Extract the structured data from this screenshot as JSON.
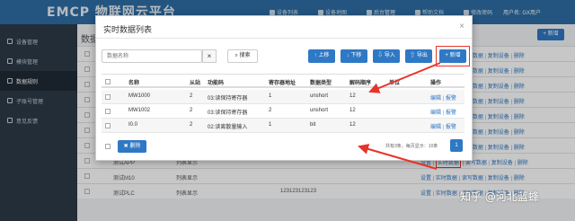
{
  "app": {
    "logo": "EMCP 物联网云平台"
  },
  "topnav": [
    "设备列表",
    "设备地图",
    "后台管理",
    "帮助文档",
    "修改密码"
  ],
  "user": {
    "label": "用户名: GX用户"
  },
  "sidebar": {
    "items": [
      {
        "label": "设备管理",
        "active": false
      },
      {
        "label": "模块管理",
        "active": false
      },
      {
        "label": "数据规则",
        "active": true
      },
      {
        "label": "子账号管理",
        "active": false
      },
      {
        "label": "意见反馈",
        "active": false
      }
    ]
  },
  "background": {
    "title": "数据",
    "add_label": "+ 新增",
    "rows": [
      {
        "name": "",
        "desc": "",
        "actions": [
          "设置",
          "实时数据",
          "读写数据",
          "复制设备",
          "删除"
        ]
      },
      {
        "name": "",
        "desc": "",
        "actions": [
          "设置",
          "实时数据",
          "读写数据",
          "复制设备",
          "删除"
        ]
      },
      {
        "name": "",
        "desc": "",
        "actions": [
          "设置",
          "实时数据",
          "读写数据",
          "复制设备",
          "删除"
        ]
      },
      {
        "name": "",
        "desc": "",
        "actions": [
          "设置",
          "实时数据",
          "读写数据",
          "复制设备",
          "删除"
        ]
      },
      {
        "name": "",
        "desc": "",
        "actions": [
          "设置",
          "实时数据",
          "读写数据",
          "复制设备",
          "删除"
        ]
      },
      {
        "name": "",
        "desc": "",
        "actions": [
          "设置",
          "实时数据",
          "读写数据",
          "复制设备",
          "删除"
        ]
      },
      {
        "name": "",
        "desc": "",
        "actions": [
          "设置",
          "实时数据",
          "读写数据",
          "复制设备",
          "删除"
        ]
      },
      {
        "name": "测试APP",
        "desc": "列表显示",
        "actions": [
          "设置",
          "实时数据",
          "读写数据",
          "复制设备",
          "删除"
        ]
      },
      {
        "name": "测试M10",
        "desc": "列表显示",
        "actions": [
          "设置",
          "实时数据",
          "读写数据",
          "复制设备",
          "删除"
        ]
      },
      {
        "name": "测试PLC",
        "desc": "列表显示",
        "serial": "123123123123",
        "actions": [
          "设置",
          "实时数据",
          "读写数据",
          "复制设备",
          "删除"
        ]
      }
    ]
  },
  "modal": {
    "title": "实时数据列表",
    "close": "×",
    "search_placeholder": "数据名称",
    "clear": "×",
    "search_label": "搜索",
    "toolbar": {
      "up": "上移",
      "down": "下移",
      "import": "导入",
      "export": "导出",
      "add": "新增"
    },
    "columns": [
      "名称",
      "从站",
      "功能码",
      "寄存器地址",
      "数据类型",
      "解码顺序",
      "单位",
      "操作"
    ],
    "rows": [
      {
        "name": "MW1000",
        "slave": "2",
        "func": "03:读保持寄存器",
        "addr": "1",
        "type": "unshort",
        "order": "12",
        "unit": "",
        "edit": "编辑",
        "alarm": "报警"
      },
      {
        "name": "MW1002",
        "slave": "2",
        "func": "03:读保持寄存器",
        "addr": "2",
        "type": "unshort",
        "order": "12",
        "unit": "",
        "edit": "编辑",
        "alarm": "报警"
      },
      {
        "name": "I0.0",
        "slave": "2",
        "func": "02:读离散量输入",
        "addr": "1",
        "type": "bit",
        "order": "12",
        "unit": "",
        "edit": "编辑",
        "alarm": "报警"
      }
    ],
    "delete_label": "删除",
    "pager_info": "共有3条，每页显示：10条",
    "page": "1"
  },
  "watermark": "知乎 @河北蓝蜂",
  "colors": {
    "primary": "#2f78c4",
    "highlight": "#e8332a",
    "topbar": "#2e6da4",
    "sidebar": "#2d3a48"
  }
}
